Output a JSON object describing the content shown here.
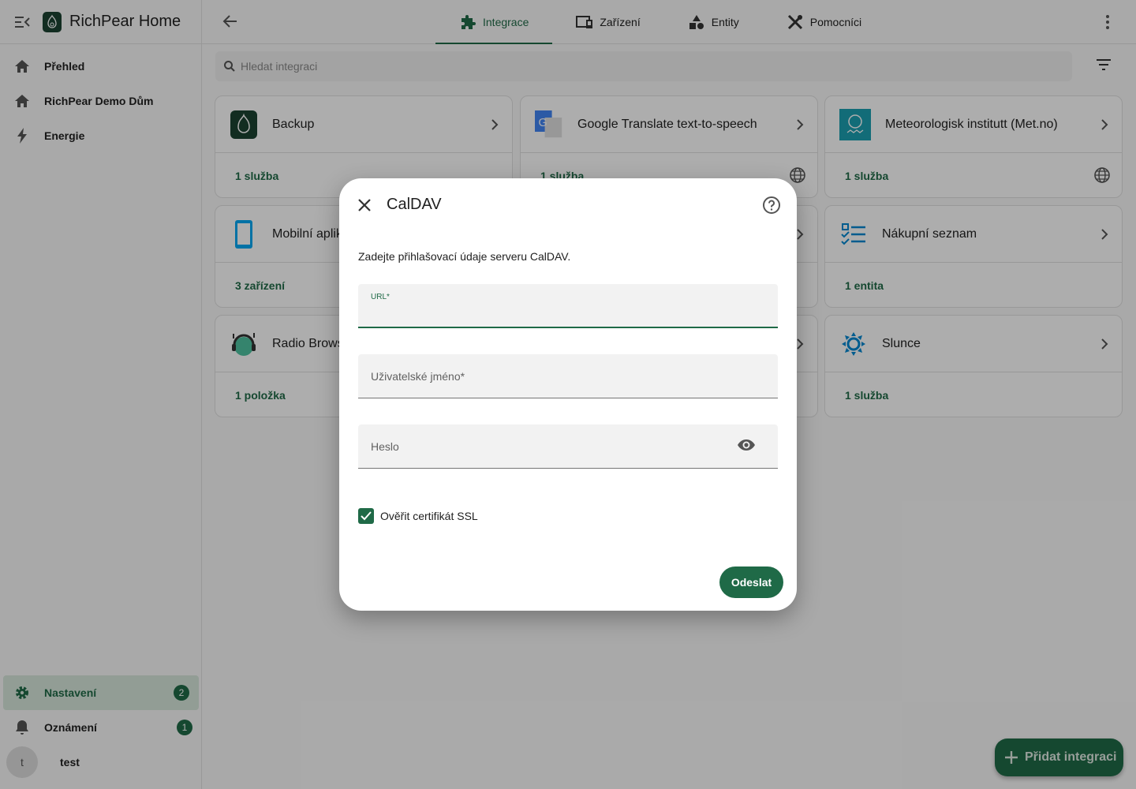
{
  "sidebar": {
    "app_title": "RichPear Home",
    "items": [
      {
        "label": "Přehled",
        "icon": "home-icon"
      },
      {
        "label": "RichPear Demo Dům",
        "icon": "home-outline-icon"
      },
      {
        "label": "Energie",
        "icon": "lightning-icon"
      }
    ],
    "settings": {
      "label": "Nastavení",
      "badge": "2"
    },
    "notifications": {
      "label": "Oznámení",
      "badge": "1"
    },
    "user": {
      "initial": "t",
      "name": "test"
    }
  },
  "topbar": {
    "tabs": [
      {
        "label": "Integrace",
        "icon": "puzzle-icon",
        "active": true
      },
      {
        "label": "Zařízení",
        "icon": "devices-icon",
        "active": false
      },
      {
        "label": "Entity",
        "icon": "shapes-icon",
        "active": false
      },
      {
        "label": "Pomocníci",
        "icon": "tools-icon",
        "active": false
      }
    ]
  },
  "search": {
    "placeholder": "Hledat integraci"
  },
  "cards": [
    {
      "name": "Backup",
      "footer": "1 služba"
    },
    {
      "name": "Google Translate text-to-speech",
      "footer": "1 služba"
    },
    {
      "name": "Meteorologisk institutt (Met.no)",
      "footer": "1 služba"
    },
    {
      "name": "Mobilní aplik",
      "footer": "3 zařízení"
    },
    {
      "name": "Nákupní seznam",
      "footer": "1 entita"
    },
    {
      "name": "Radio Brows",
      "footer": "1 položka"
    },
    {
      "name": "Slunce",
      "footer": "1 služba"
    }
  ],
  "fab": {
    "label": "Přidat integraci"
  },
  "dialog": {
    "title": "CalDAV",
    "description": "Zadejte přihlašovací údaje serveru CalDAV.",
    "fields": {
      "url": {
        "label": "URL*",
        "value": ""
      },
      "username": {
        "label": "Uživatelské jméno*",
        "value": ""
      },
      "password": {
        "label": "Heslo",
        "value": ""
      }
    },
    "checkbox": {
      "label": "Ověřit certifikát SSL",
      "checked": true
    },
    "submit_label": "Odeslat"
  },
  "colors": {
    "accent": "#1f6a47",
    "active_bg": "#d7e7dc"
  }
}
